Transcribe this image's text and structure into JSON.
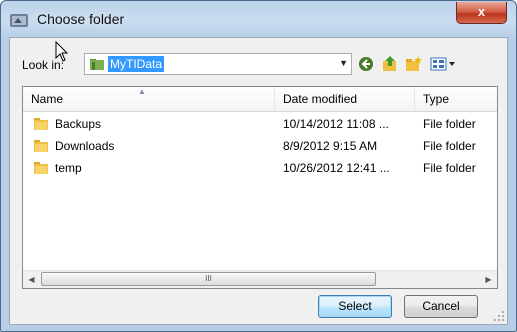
{
  "window": {
    "title": "Choose folder",
    "close_label": "x"
  },
  "lookin": {
    "label": "Look in:",
    "value": "MyTIData"
  },
  "columns": [
    {
      "label": "Name"
    },
    {
      "label": "Date modified"
    },
    {
      "label": "Type"
    }
  ],
  "rows": [
    {
      "name": "Backups",
      "date": "10/14/2012 11:08 ...",
      "type": "File folder"
    },
    {
      "name": "Downloads",
      "date": "8/9/2012 9:15 AM",
      "type": "File folder"
    },
    {
      "name": "temp",
      "date": "10/26/2012 12:41 ...",
      "type": "File folder"
    }
  ],
  "scrollbar": {
    "thumb_grip": "III"
  },
  "buttons": {
    "select": "Select",
    "cancel": "Cancel"
  },
  "colors": {
    "folder": "#f2c040",
    "selection": "#3399ff",
    "close": "#c9452c"
  }
}
